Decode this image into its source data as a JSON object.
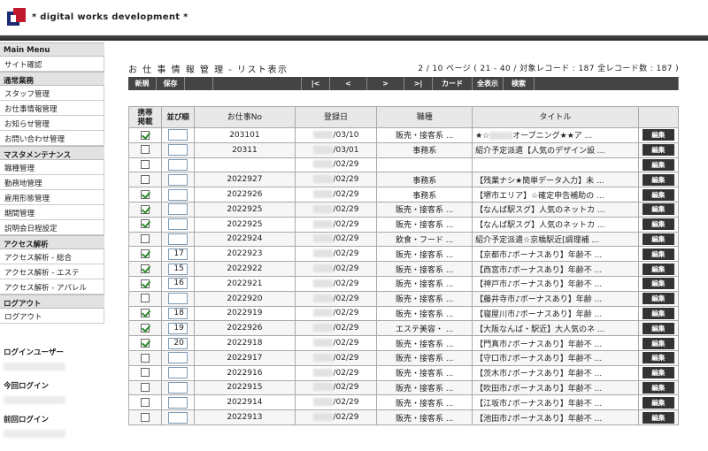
{
  "site_title": "* digital works development *",
  "sidebar": {
    "sections": [
      {
        "label": "Main Menu",
        "items": [
          "サイト確認"
        ]
      },
      {
        "label": "通常業務",
        "items": [
          "スタッフ管理",
          "お仕事情報管理",
          "お知らせ管理",
          "お問い合わせ管理"
        ]
      },
      {
        "label": "マスタメンテナンス",
        "items": [
          "職種管理",
          "勤務地管理",
          "雇用形態管理",
          "期間管理",
          "説明会日程設定"
        ]
      },
      {
        "label": "アクセス解析",
        "items": [
          "アクセス解析 - 総合",
          "アクセス解析 - エステ",
          "アクセス解析 - アパレル"
        ]
      },
      {
        "label": "ログアウト",
        "items": [
          "ログアウト"
        ]
      }
    ],
    "login": [
      "ログインユーザー",
      "今回ログイン",
      "前回ログイン"
    ]
  },
  "page_title": "お 仕 事 情 報 管 理 - リスト表示",
  "page_info": "2 / 10 ページ ( 21 - 40 / 対象レコード : 187 全レコード数 : 187 )",
  "toolbar": {
    "new": "新規",
    "save": "保存",
    "first": "|<",
    "prev": "<",
    "next": ">",
    "last": ">|",
    "card": "カード",
    "all": "全表示",
    "search": "検索"
  },
  "columns": {
    "mobile": "携帯\n掲載",
    "order": "並び順",
    "job_no": "お仕事No",
    "date": "登録日",
    "category": "職種",
    "title": "タイトル",
    "edit": ""
  },
  "edit_label": "編集",
  "rows": [
    {
      "checked": true,
      "order": "",
      "job_no": "203101",
      "date": "/03/10",
      "category": "販売・接客系 ...",
      "title_prefix": "★☆",
      "title": "オープニング★★ア ..."
    },
    {
      "checked": false,
      "order": "",
      "job_no": "20311",
      "date": "/03/01",
      "category": "事務系",
      "title_prefix": "",
      "title": "紹介予定派遣【人気のデザイン設 ..."
    },
    {
      "checked": false,
      "order": "",
      "job_no": "",
      "date": "/02/29",
      "category": "",
      "title_prefix": "",
      "title": ""
    },
    {
      "checked": false,
      "order": "",
      "job_no": "2022927",
      "date": "/02/29",
      "category": "事務系",
      "title_prefix": "",
      "title": "【残業ナシ★簡単データ入力】未 ..."
    },
    {
      "checked": true,
      "order": "",
      "job_no": "2022926",
      "date": "/02/29",
      "category": "事務系",
      "title_prefix": "",
      "title": "【堺市エリア】☆確定申告補助の ..."
    },
    {
      "checked": true,
      "order": "",
      "job_no": "2022925",
      "date": "/02/29",
      "category": "販売・接客系 ...",
      "title_prefix": "",
      "title": "【なんば駅スグ】人気のネットカ ..."
    },
    {
      "checked": true,
      "order": "",
      "job_no": "2022925",
      "date": "/02/29",
      "category": "販売・接客系 ...",
      "title_prefix": "",
      "title": "【なんば駅スグ】人気のネットカ ..."
    },
    {
      "checked": false,
      "order": "",
      "job_no": "2022924",
      "date": "/02/29",
      "category": "飲食・フード ...",
      "title_prefix": "",
      "title": "紹介予定派遣☆京橋駅近[調理補 ..."
    },
    {
      "checked": true,
      "order": "17",
      "job_no": "2022923",
      "date": "/02/29",
      "category": "販売・接客系 ...",
      "title_prefix": "",
      "title": "【京都市♪ボーナスあり】年齢不 ..."
    },
    {
      "checked": true,
      "order": "15",
      "job_no": "2022922",
      "date": "/02/29",
      "category": "販売・接客系 ...",
      "title_prefix": "",
      "title": "【西宮市♪ボーナスあり】年齢不 ..."
    },
    {
      "checked": true,
      "order": "16",
      "job_no": "2022921",
      "date": "/02/29",
      "category": "販売・接客系 ...",
      "title_prefix": "",
      "title": "【神戸市♪ボーナスあり】年齢不 ..."
    },
    {
      "checked": false,
      "order": "",
      "job_no": "2022920",
      "date": "/02/29",
      "category": "販売・接客系 ...",
      "title_prefix": "",
      "title": "【藤井寺市♪ボーナスあり】年齢 ..."
    },
    {
      "checked": true,
      "order": "18",
      "job_no": "2022919",
      "date": "/02/29",
      "category": "販売・接客系 ...",
      "title_prefix": "",
      "title": "【寝屋川市♪ボーナスあり】年齢 ..."
    },
    {
      "checked": true,
      "order": "19",
      "job_no": "2022926",
      "date": "/02/29",
      "category": "エステ美容・ ...",
      "title_prefix": "",
      "title": "【大阪なんば・駅近】大人気のネ ..."
    },
    {
      "checked": true,
      "order": "20",
      "job_no": "2022918",
      "date": "/02/29",
      "category": "販売・接客系 ...",
      "title_prefix": "",
      "title": "【門真市♪ボーナスあり】年齢不 ..."
    },
    {
      "checked": false,
      "order": "",
      "job_no": "2022917",
      "date": "/02/29",
      "category": "販売・接客系 ...",
      "title_prefix": "",
      "title": "【守口市♪ボーナスあり】年齢不 ..."
    },
    {
      "checked": false,
      "order": "",
      "job_no": "2022916",
      "date": "/02/29",
      "category": "販売・接客系 ...",
      "title_prefix": "",
      "title": "【茨木市♪ボーナスあり】年齢不 ..."
    },
    {
      "checked": false,
      "order": "",
      "job_no": "2022915",
      "date": "/02/29",
      "category": "販売・接客系 ...",
      "title_prefix": "",
      "title": "【吹田市♪ボーナスあり】年齢不 ..."
    },
    {
      "checked": false,
      "order": "",
      "job_no": "2022914",
      "date": "/02/29",
      "category": "販売・接客系 ...",
      "title_prefix": "",
      "title": "【江坂市♪ボーナスあり】年齢不 ..."
    },
    {
      "checked": false,
      "order": "",
      "job_no": "2022913",
      "date": "/02/29",
      "category": "販売・接客系 ...",
      "title_prefix": "",
      "title": "【池田市♪ボーナスあり】年齢不 ..."
    }
  ],
  "colors": {
    "toolbar": "#444444",
    "topbar": "#333333",
    "edit_button": "#333333",
    "check": "#2a8a2a"
  }
}
